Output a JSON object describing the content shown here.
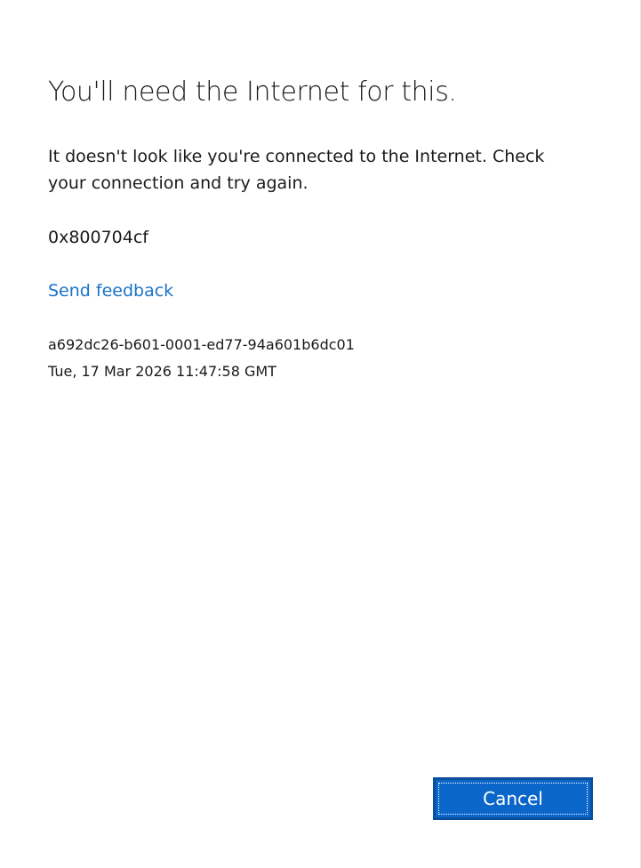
{
  "dialog": {
    "title": "You'll need the Internet for this.",
    "message": "It doesn't look like you're connected to the Internet. Check your connection and try again.",
    "error_code": "0x800704cf",
    "feedback_link": "Send feedback",
    "correlation_id": "a692dc26-b601-0001-ed77-94a601b6dc01",
    "timestamp": "Tue, 17 Mar 2026 11:47:58 GMT",
    "cancel_label": "Cancel"
  },
  "colors": {
    "link": "#1a73c8",
    "button_background": "#0a67c9",
    "button_border": "#0a4f9c",
    "text": "#1a1a1a",
    "background": "#ffffff"
  }
}
